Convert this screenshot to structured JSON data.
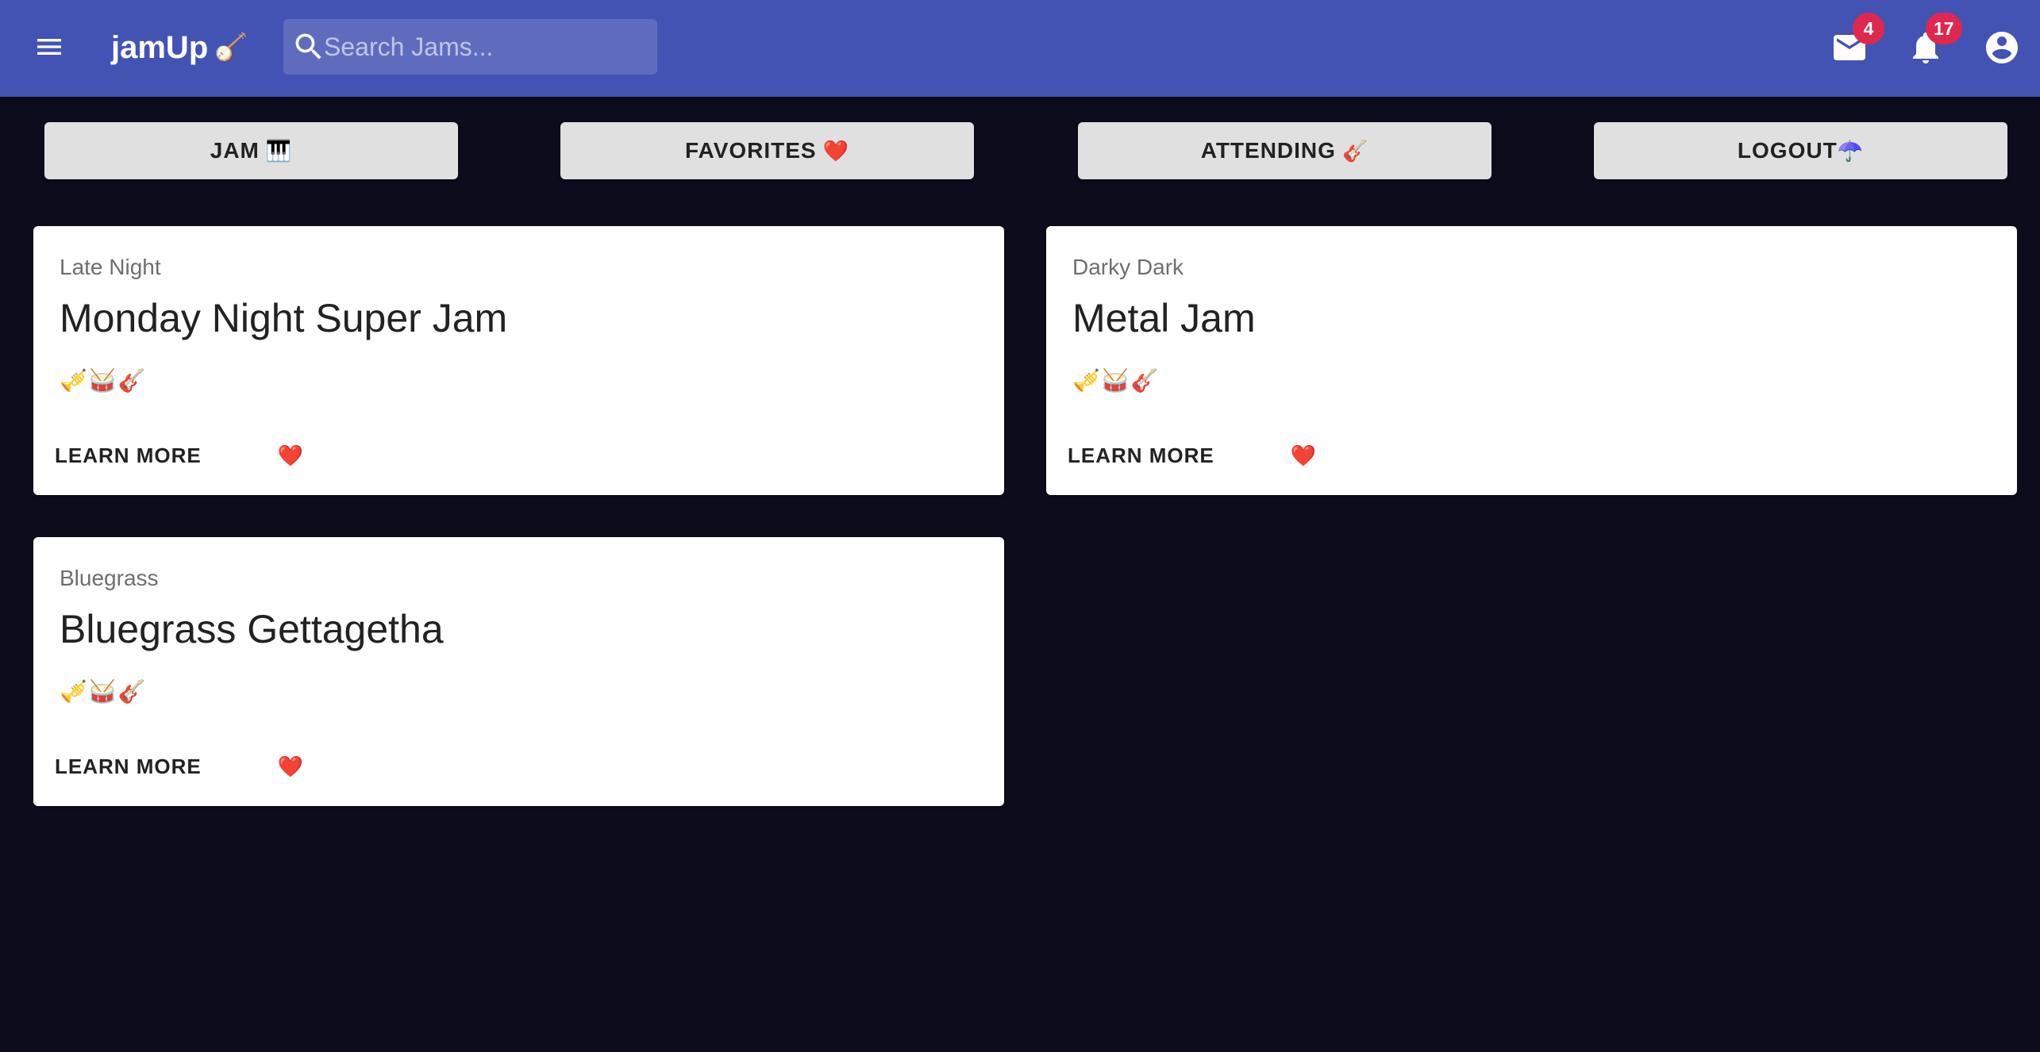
{
  "header": {
    "brand_name": "jamUp",
    "brand_emoji": "🪕",
    "search_placeholder": "Search Jams...",
    "mail_count": "4",
    "notification_count": "17",
    "icons": {
      "menu": "menu-icon",
      "search": "search-icon",
      "mail": "mail-icon",
      "notifications": "bell-icon",
      "account": "account-circle-icon"
    }
  },
  "nav": {
    "jam": {
      "label": "JAM",
      "emoji": "🎹"
    },
    "favorites": {
      "label": "FAVORITES",
      "emoji": "❤️"
    },
    "attending": {
      "label": "ATTENDING",
      "emoji": "🎸"
    },
    "logout": {
      "label": "LOGOUT",
      "emoji": "☂️"
    }
  },
  "jams": [
    {
      "genre": "Late Night",
      "title": "Monday Night Super Jam",
      "instruments": "🎺🥁🎸",
      "learn_more": "LEARN MORE",
      "favorite": "❤️"
    },
    {
      "genre": "Darky Dark",
      "title": "Metal Jam",
      "instruments": "🎺🥁🎸",
      "learn_more": "LEARN MORE",
      "favorite": "❤️"
    },
    {
      "genre": "Bluegrass",
      "title": "Bluegrass Gettagetha",
      "instruments": "🎺🥁🎸",
      "learn_more": "LEARN MORE",
      "favorite": "❤️"
    }
  ],
  "colors": {
    "appbar": "#4353b3",
    "background": "#0d0c1d",
    "badge": "#e0274d",
    "nav_button": "#e0e0e0",
    "card": "#ffffff"
  }
}
